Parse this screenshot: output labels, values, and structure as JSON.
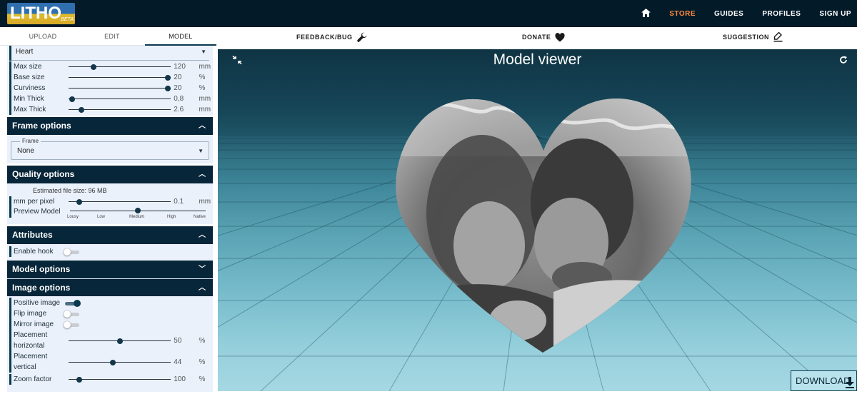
{
  "brand": {
    "name": "LITHO",
    "badge": "BETA"
  },
  "nav": {
    "items": [
      "STORE",
      "GUIDES",
      "PROFILES",
      "SIGN UP"
    ],
    "active": "STORE"
  },
  "tabs": [
    {
      "label": "UPLOAD",
      "active": false
    },
    {
      "label": "EDIT",
      "active": false
    },
    {
      "label": "MODEL",
      "active": true
    }
  ],
  "actions": {
    "feedback": "FEEDBACK/BUG",
    "donate": "DONATE",
    "suggestion": "SUGGESTION"
  },
  "shape": {
    "selected": "Heart"
  },
  "shape_settings": {
    "max_size": {
      "label": "Max size",
      "value": "120",
      "unit": "mm",
      "fraction": 0.24
    },
    "base_size": {
      "label": "Base size",
      "value": "20",
      "unit": "%",
      "fraction": 0.97
    },
    "curviness": {
      "label": "Curviness",
      "value": "20",
      "unit": "%",
      "fraction": 0.97
    },
    "min_thick": {
      "label": "Min Thick",
      "value": "0,8",
      "unit": "mm",
      "fraction": 0.03
    },
    "max_thick": {
      "label": "Max Thick",
      "value": "2.6",
      "unit": "mm",
      "fraction": 0.12
    }
  },
  "frame_options": {
    "title": "Frame options",
    "frame_legend": "Frame",
    "frame_value": "None"
  },
  "quality_options": {
    "title": "Quality options",
    "estimated": "Estimated file size: 96 MB",
    "mm_per_pixel": {
      "label": "mm per pixel",
      "value": "0.1",
      "unit": "mm",
      "fraction": 0.1
    },
    "preview_model": {
      "label": "Preview Model",
      "levels": [
        "Lousy",
        "Low",
        "Medium",
        "High",
        "Native"
      ],
      "selected": "Medium"
    }
  },
  "attributes": {
    "title": "Attributes",
    "enable_hook": {
      "label": "Enable hook",
      "on": false
    }
  },
  "model_options": {
    "title": "Model options"
  },
  "image_options": {
    "title": "Image options",
    "positive_image": {
      "label": "Positive image",
      "on": true
    },
    "flip_image": {
      "label": "Flip image",
      "on": false
    },
    "mirror_image": {
      "label": "Mirror image",
      "on": false
    },
    "placement_horizontal": {
      "label_line1": "Placement",
      "label_line2": "horizontal",
      "value": "50",
      "unit": "%",
      "fraction": 0.5
    },
    "placement_vertical": {
      "label_line1": "Placement",
      "label_line2": "vertical",
      "value": "44",
      "unit": "%",
      "fraction": 0.43
    },
    "zoom_factor": {
      "label": "Zoom factor",
      "value": "100",
      "unit": "%",
      "fraction": 0.1
    }
  },
  "viewer": {
    "title": "Model viewer",
    "download_label": "DOWNLOAD"
  },
  "colors": {
    "navy": "#08263a",
    "accent": "#ff8a3d",
    "panel": "#eaf1fb",
    "sky_top": "#0f3444",
    "sky_bottom": "#a5d8e3"
  },
  "icons": [
    "home-icon",
    "wrench-icon",
    "heart-icon",
    "pen-icon",
    "collapse-icon",
    "refresh-icon",
    "download-icon",
    "chevron-up-icon",
    "chevron-down-icon",
    "dropdown-arrow-icon"
  ]
}
